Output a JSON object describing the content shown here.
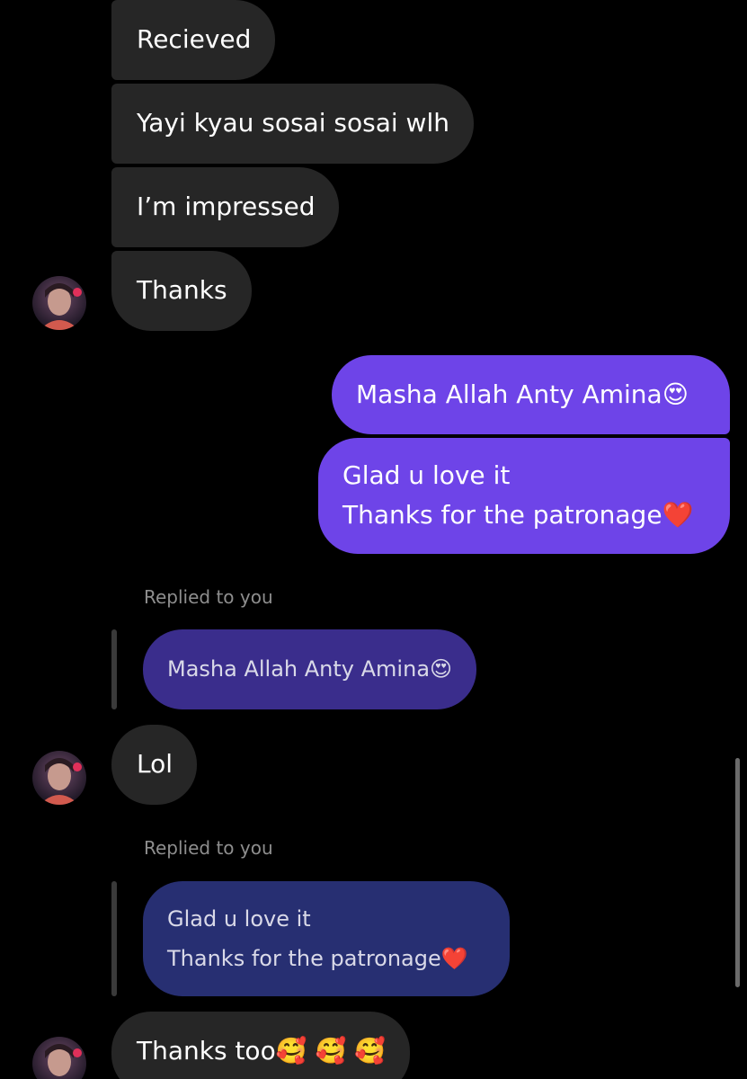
{
  "messages": {
    "m1": "Recieved",
    "m2": "Yayi kyau sosai sosai wlh",
    "m3": "I’m impressed",
    "m4": "Thanks",
    "out1": "Masha Allah Anty Amina😍",
    "out2_line1": "Glad u love it",
    "out2_line2": "Thanks for the patronage❤️",
    "reply1_label": "Replied to you",
    "reply1_quote": "Masha Allah Anty Amina😍",
    "m5": "Lol",
    "reply2_label": "Replied to you",
    "reply2_quote_line1": "Glad u love it",
    "reply2_quote_line2": "Thanks for the patronage❤️",
    "m6": "Thanks too🥰 🥰 🥰"
  },
  "colors": {
    "background": "#000000",
    "incoming_bubble": "#262626",
    "outgoing_bubble": "#6e44e8",
    "reply_quote_1": "#3a2d8c",
    "reply_quote_2": "#272f72",
    "secondary_text": "#8e8e8e"
  },
  "icons": {
    "avatar": "contact-avatar"
  }
}
